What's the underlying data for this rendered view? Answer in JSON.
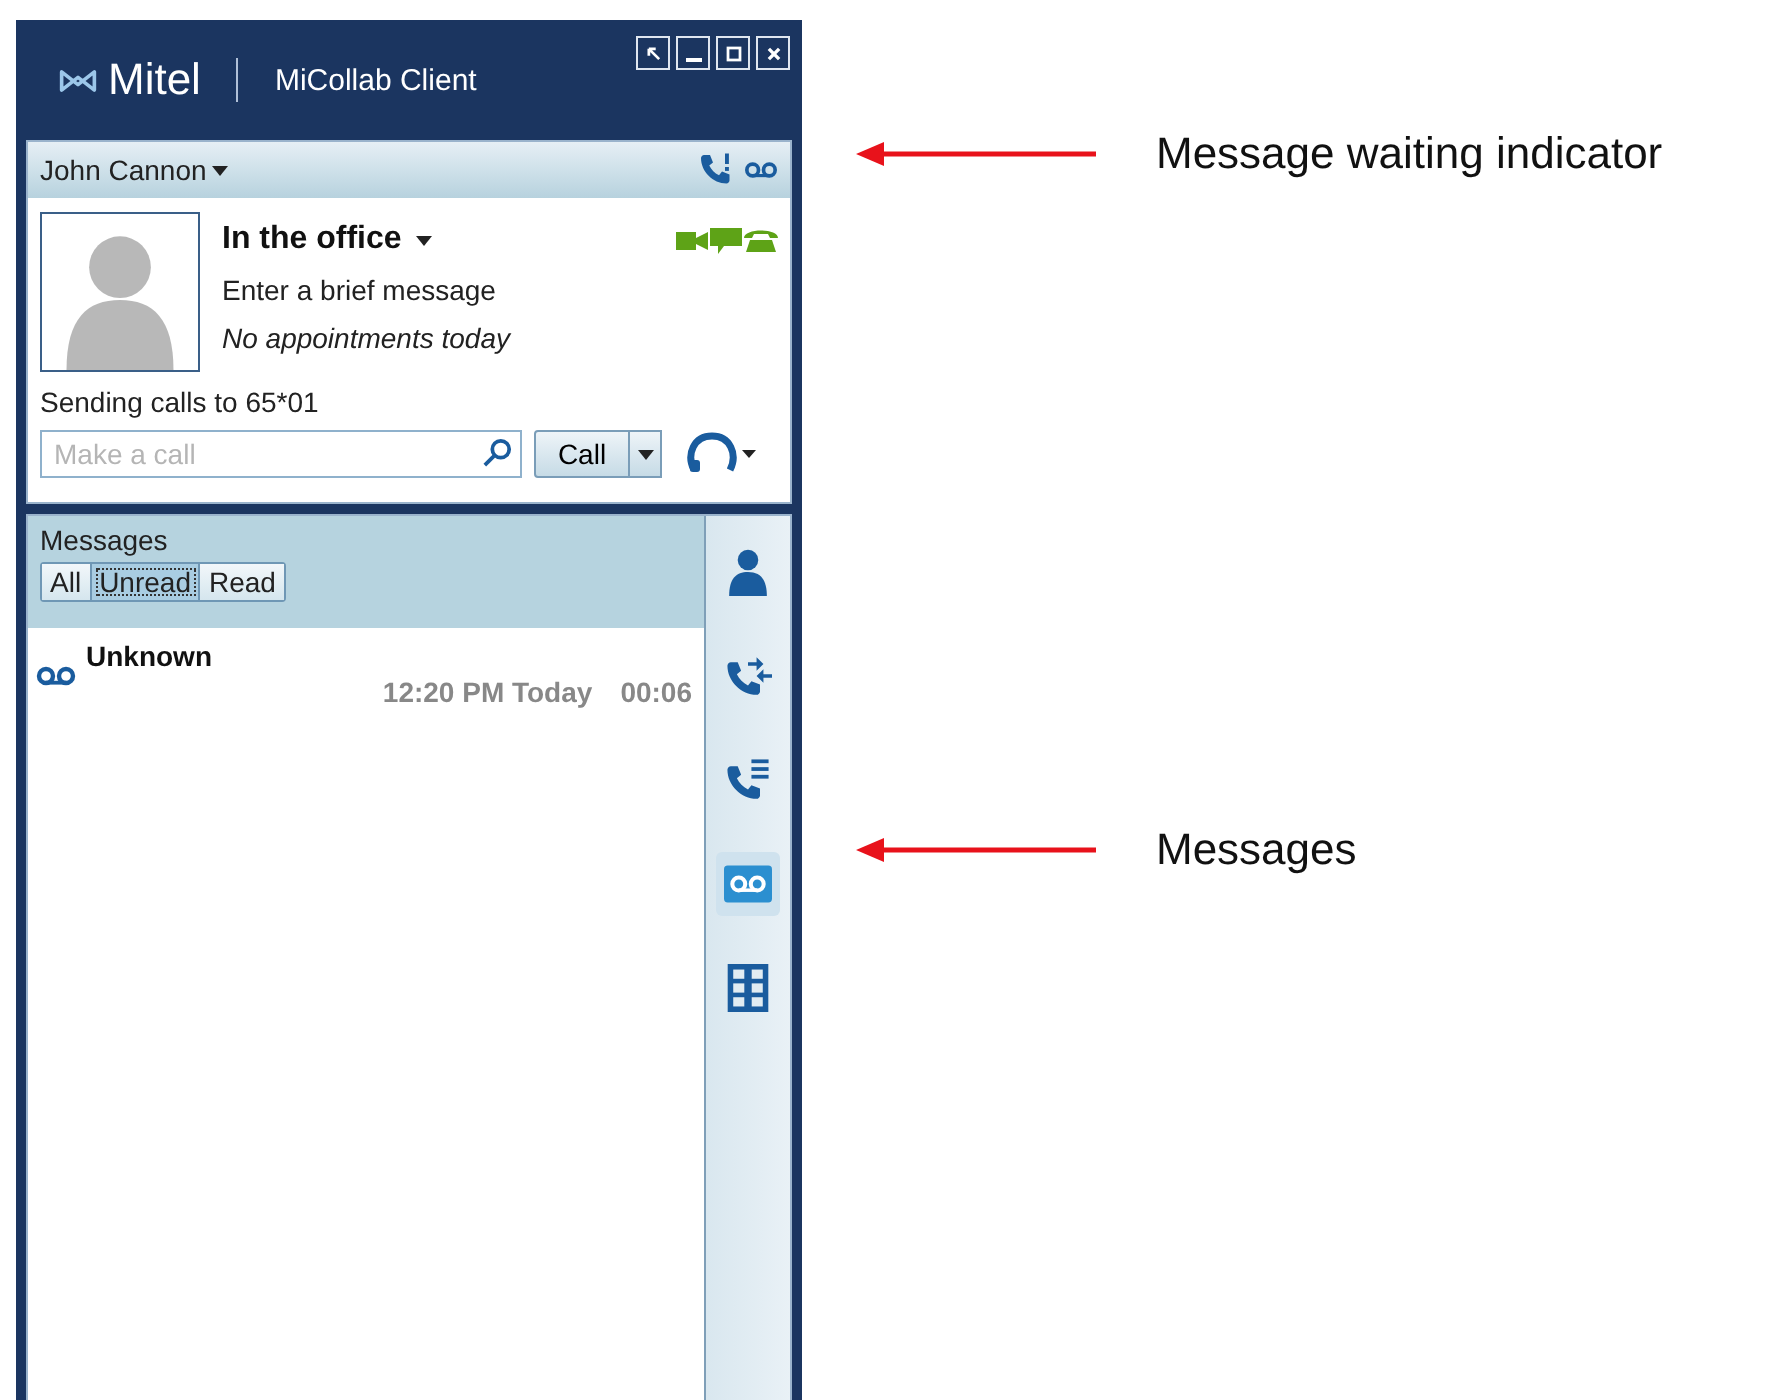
{
  "window": {
    "brand": "Mitel",
    "title": "MiCollab Client"
  },
  "profile": {
    "name": "John Cannon",
    "status": "In the office",
    "message": {
      "placeholder": "Enter a brief message"
    },
    "appointments": "No appointments today",
    "forwarding": "Sending calls to 65*01",
    "call_field": {
      "placeholder": "Make a call"
    },
    "call_button": "Call"
  },
  "messages": {
    "title": "Messages",
    "filters": [
      {
        "label": "All",
        "selected": false
      },
      {
        "label": "Unread",
        "selected": true
      },
      {
        "label": "Read",
        "selected": false
      }
    ],
    "items": [
      {
        "caller": "Unknown",
        "time": "12:20 PM Today",
        "duration": "00:06"
      }
    ]
  },
  "rail": [
    {
      "kind": "contacts",
      "selected": false
    },
    {
      "kind": "call-history",
      "selected": false
    },
    {
      "kind": "call-log",
      "selected": false
    },
    {
      "kind": "voicemail",
      "selected": true
    },
    {
      "kind": "dialpad",
      "selected": false
    }
  ],
  "annotations": [
    {
      "text": "Message waiting indicator"
    },
    {
      "text": "Messages"
    }
  ]
}
